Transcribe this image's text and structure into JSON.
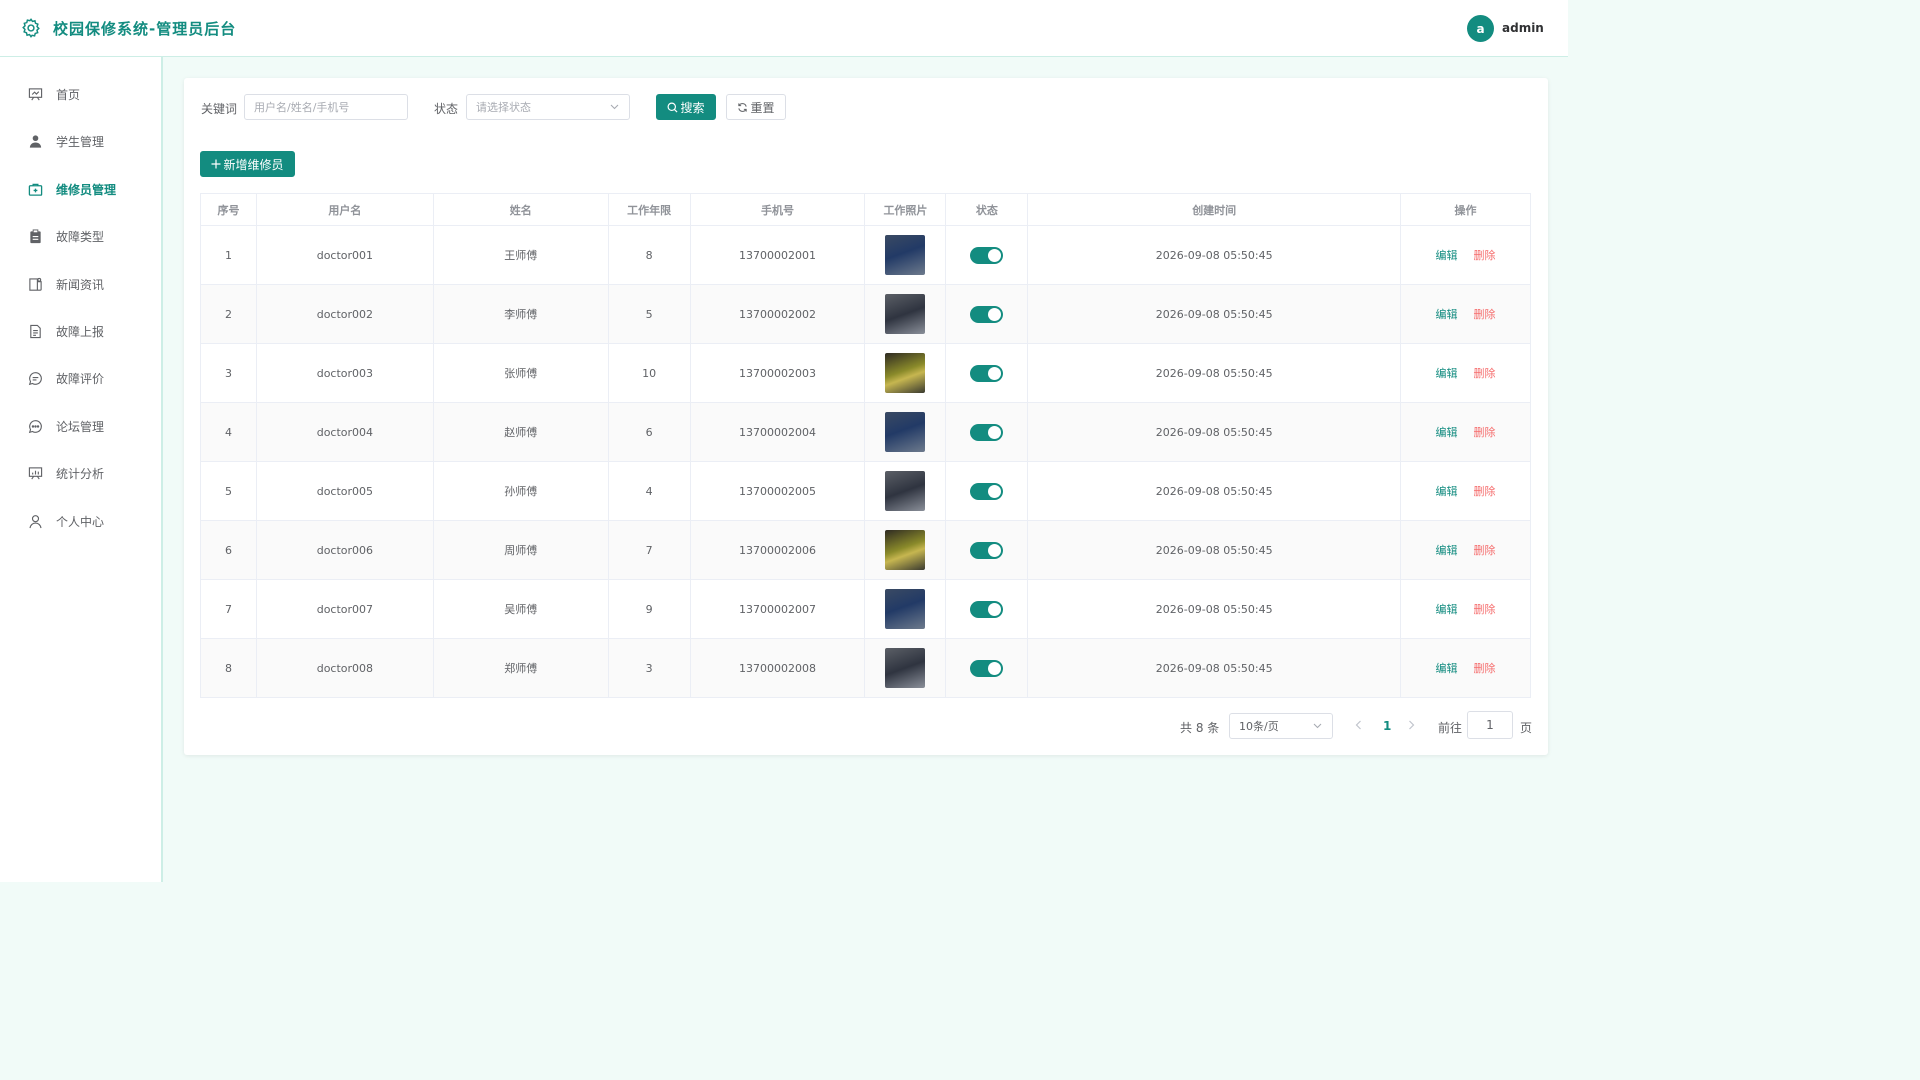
{
  "header": {
    "title": "校园保修系统-管理员后台",
    "avatar_letter": "a",
    "username": "admin"
  },
  "sidebar": {
    "items": [
      {
        "label": "首页",
        "icon": "dashboard-icon"
      },
      {
        "label": "学生管理",
        "icon": "user-icon"
      },
      {
        "label": "维修员管理",
        "icon": "toolbox-icon",
        "active": true
      },
      {
        "label": "故障类型",
        "icon": "clipboard-icon"
      },
      {
        "label": "新闻资讯",
        "icon": "news-icon"
      },
      {
        "label": "故障上报",
        "icon": "document-icon"
      },
      {
        "label": "故障评价",
        "icon": "chat-bubble-icon"
      },
      {
        "label": "论坛管理",
        "icon": "forum-icon"
      },
      {
        "label": "统计分析",
        "icon": "chart-icon"
      },
      {
        "label": "个人中心",
        "icon": "profile-icon"
      }
    ]
  },
  "filters": {
    "keyword_label": "关键词",
    "keyword_placeholder": "用户名/姓名/手机号",
    "status_label": "状态",
    "status_placeholder": "请选择状态",
    "search_label": "搜索",
    "reset_label": "重置"
  },
  "add_button_label": "新增维修员",
  "table": {
    "columns": [
      "序号",
      "用户名",
      "姓名",
      "工作年限",
      "手机号",
      "工作照片",
      "状态",
      "创建时间",
      "操作"
    ],
    "rows": [
      {
        "index": "1",
        "username": "doctor001",
        "name": "王师傅",
        "years": "8",
        "phone": "13700002001",
        "created": "2026-09-08 05:50:45"
      },
      {
        "index": "2",
        "username": "doctor002",
        "name": "李师傅",
        "years": "5",
        "phone": "13700002002",
        "created": "2026-09-08 05:50:45"
      },
      {
        "index": "3",
        "username": "doctor003",
        "name": "张师傅",
        "years": "10",
        "phone": "13700002003",
        "created": "2026-09-08 05:50:45"
      },
      {
        "index": "4",
        "username": "doctor004",
        "name": "赵师傅",
        "years": "6",
        "phone": "13700002004",
        "created": "2026-09-08 05:50:45"
      },
      {
        "index": "5",
        "username": "doctor005",
        "name": "孙师傅",
        "years": "4",
        "phone": "13700002005",
        "created": "2026-09-08 05:50:45"
      },
      {
        "index": "6",
        "username": "doctor006",
        "name": "周师傅",
        "years": "7",
        "phone": "13700002006",
        "created": "2026-09-08 05:50:45"
      },
      {
        "index": "7",
        "username": "doctor007",
        "name": "吴师傅",
        "years": "9",
        "phone": "13700002007",
        "created": "2026-09-08 05:50:45"
      },
      {
        "index": "8",
        "username": "doctor008",
        "name": "郑师傅",
        "years": "3",
        "phone": "13700002008",
        "created": "2026-09-08 05:50:45"
      }
    ],
    "edit_label": "编辑",
    "delete_label": "删除"
  },
  "pagination": {
    "total_text": "共 8 条",
    "page_size": "10条/页",
    "current_page": "1",
    "goto_label": "前往",
    "goto_value": "1",
    "page_suffix": "页"
  },
  "colors": {
    "primary": "#138c80",
    "danger": "#f56c6c",
    "background": "#f1fbf8"
  }
}
